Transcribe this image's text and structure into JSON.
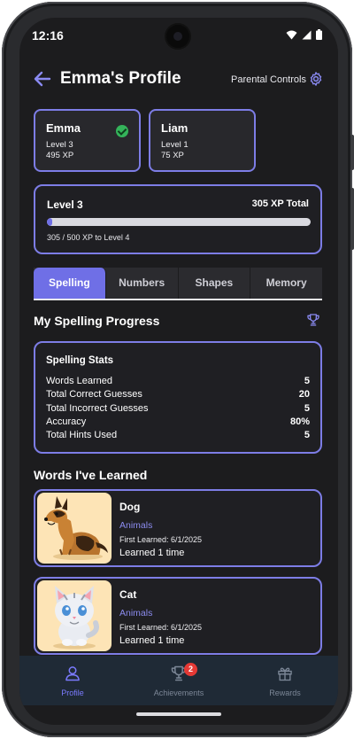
{
  "status": {
    "time": "12:16"
  },
  "header": {
    "title": "Emma's Profile",
    "parental_controls": "Parental Controls"
  },
  "children": [
    {
      "name": "Emma",
      "level": "Level 3",
      "xp": "495 XP",
      "selected": true
    },
    {
      "name": "Liam",
      "level": "Level 1",
      "xp": "75 XP",
      "selected": false
    }
  ],
  "level": {
    "title": "Level 3",
    "total": "305 XP Total",
    "progress_text": "305 / 500 XP to Level 4",
    "progress_fraction": 0.02
  },
  "tabs": [
    {
      "label": "Spelling",
      "active": true
    },
    {
      "label": "Numbers",
      "active": false
    },
    {
      "label": "Shapes",
      "active": false
    },
    {
      "label": "Memory",
      "active": false
    }
  ],
  "progress": {
    "section_title": "My Spelling Progress"
  },
  "stats": {
    "title": "Spelling Stats",
    "rows": [
      {
        "label": "Words Learned",
        "value": "5"
      },
      {
        "label": "Total Correct Guesses",
        "value": "20"
      },
      {
        "label": "Total Incorrect Guesses",
        "value": "5"
      },
      {
        "label": "Accuracy",
        "value": "80%"
      },
      {
        "label": "Total Hints Used",
        "value": "5"
      }
    ]
  },
  "words": {
    "section_title": "Words I've Learned",
    "items": [
      {
        "name": "Dog",
        "category": "Animals",
        "first_learned": "First Learned: 6/1/2025",
        "times": "Learned 1 time",
        "image": "dog-illustration"
      },
      {
        "name": "Cat",
        "category": "Animals",
        "first_learned": "First Learned: 6/1/2025",
        "times": "Learned 1 time",
        "image": "cat-illustration"
      }
    ]
  },
  "nav": {
    "items": [
      {
        "label": "Profile",
        "icon": "user-icon",
        "active": true
      },
      {
        "label": "Achievements",
        "icon": "trophy-icon",
        "badge": "2",
        "active": false
      },
      {
        "label": "Rewards",
        "icon": "gift-icon",
        "active": false
      }
    ]
  },
  "colors": {
    "accent": "#6f6fe6",
    "background": "#1c1c1e",
    "card_border": "#7d7de6",
    "success": "#34b35a",
    "badge": "#e53935"
  }
}
